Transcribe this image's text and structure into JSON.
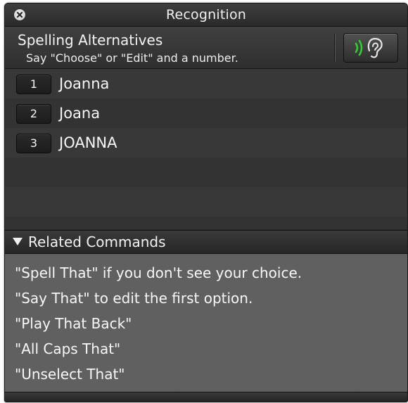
{
  "window": {
    "title": "Recognition"
  },
  "header": {
    "title": "Spelling Alternatives",
    "subtitle": "Say \"Choose\" or \"Edit\" and a number."
  },
  "choices": [
    {
      "number": "1",
      "text": "Joanna"
    },
    {
      "number": "2",
      "text": "Joana"
    },
    {
      "number": "3",
      "text": "JOANNA"
    }
  ],
  "related": {
    "title": "Related Commands",
    "commands": [
      "\"Spell That\" if you don't see your choice.",
      "\"Say That\" to edit the first option.",
      "\"Play That Back\"",
      "\"All Caps That\"",
      "\"Unselect That\""
    ]
  },
  "icons": {
    "close": "close-icon",
    "listen": "ear-icon",
    "disclosure": "triangle-down-icon"
  },
  "colors": {
    "listen_wave": "#39c639",
    "background": "#2b2b2b",
    "commands_background": "#606060"
  }
}
